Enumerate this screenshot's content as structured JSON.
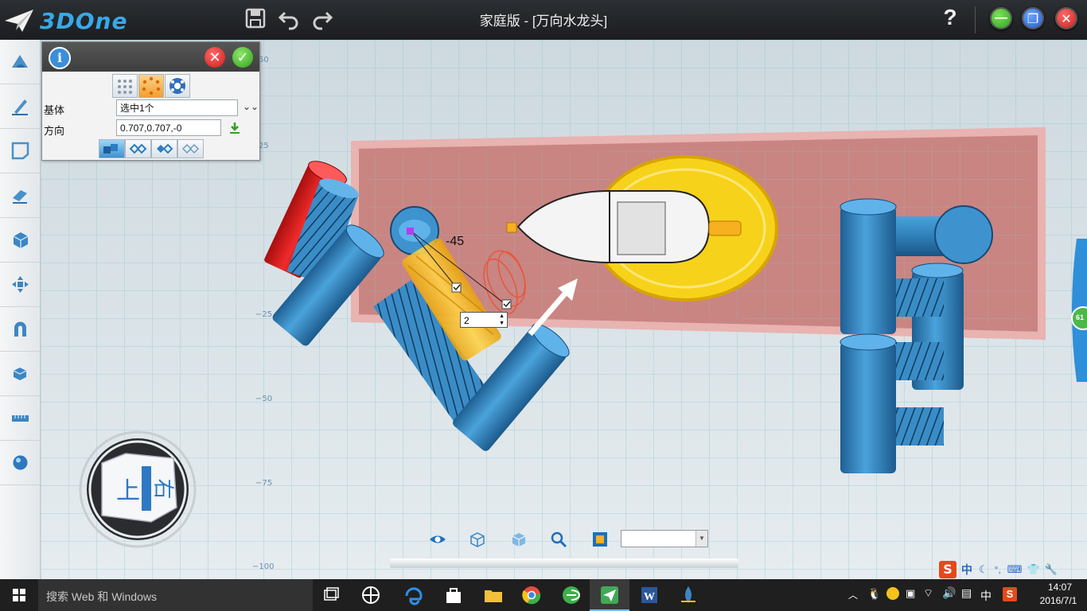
{
  "app": {
    "logo_text": "3DOne",
    "title": "家庭版 - [万向水龙头]",
    "help_label": "?"
  },
  "title_toolbar": [
    {
      "icon": "save-icon"
    },
    {
      "icon": "undo-icon"
    },
    {
      "icon": "redo-icon"
    }
  ],
  "left_toolbar": [
    {
      "icon": "basic-solid-icon"
    },
    {
      "icon": "sketch-pen-icon"
    },
    {
      "icon": "sketch-edit-icon"
    },
    {
      "icon": "eraser-feature-icon"
    },
    {
      "icon": "special-function-icon"
    },
    {
      "icon": "basic-edit-icon"
    },
    {
      "icon": "magnet-combine-icon"
    },
    {
      "icon": "auto-snap-icon"
    },
    {
      "icon": "distance-measure-icon"
    },
    {
      "icon": "material-render-icon"
    }
  ],
  "panel": {
    "info_icon": "i",
    "cancel_label": "✕",
    "ok_label": "✓",
    "base_label": "基体",
    "base_value": "选中1个",
    "direction_label": "方向",
    "direction_value": "0.707,0.707,-0"
  },
  "axis_labels": [
    "50",
    "25",
    "−25",
    "−50",
    "−75",
    "−100"
  ],
  "dimension": {
    "angle_value": "-45",
    "count_value": "2",
    "right_handle_value": "61"
  },
  "view_cube": {
    "face_top": "上",
    "face_right": "右"
  },
  "view_bar": {
    "select_value": ""
  },
  "ime": {
    "brand": "S",
    "lang": "中"
  },
  "taskbar": {
    "search_placeholder": "搜索 Web 和 Windows",
    "tray_lang": "中",
    "time": "14:07",
    "date": "2016/7/1"
  },
  "colors": {
    "accent_blue": "#2f7fb0",
    "part_red": "#e61e1e",
    "selection_yellow": "#f7d21a",
    "plate_pink": "#c98582"
  }
}
